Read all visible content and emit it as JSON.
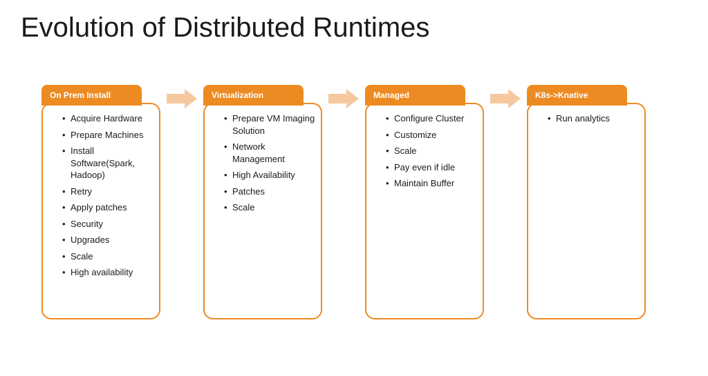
{
  "title": "Evolution of Distributed Runtimes",
  "colors": {
    "accent": "#ED8B23",
    "arrow": "#F6C89F"
  },
  "phases": [
    {
      "title": "On Prem Install",
      "items": [
        "Acquire Hardware",
        "Prepare Machines",
        "Install Software(Spark, Hadoop)",
        "Retry",
        "Apply patches",
        "Security",
        "Upgrades",
        "Scale",
        "High availability"
      ]
    },
    {
      "title": "Virtualization",
      "items": [
        "Prepare VM Imaging Solution",
        "Network Management",
        "High Availability",
        "Patches",
        "Scale"
      ]
    },
    {
      "title": "Managed",
      "items": [
        "Configure Cluster",
        "Customize",
        "Scale",
        "Pay even if idle",
        "Maintain Buffer"
      ]
    },
    {
      "title": "K8s->Knative",
      "items": [
        "Run analytics"
      ]
    }
  ]
}
